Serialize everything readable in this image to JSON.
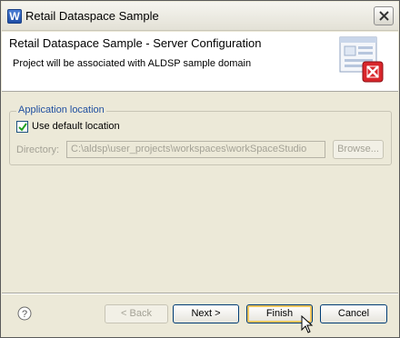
{
  "window": {
    "title": "Retail Dataspace Sample"
  },
  "header": {
    "title": "Retail Dataspace Sample - Server Configuration",
    "description": "Project will be associated with ALDSP sample domain"
  },
  "location_group": {
    "label": "Application location",
    "use_default_label": "Use default location",
    "use_default_checked": true,
    "directory_label": "Directory:",
    "directory_value": "C:\\aldsp\\user_projects\\workspaces\\workSpaceStudio",
    "browse_label": "Browse..."
  },
  "buttons": {
    "back": "< Back",
    "next": "Next >",
    "finish": "Finish",
    "cancel": "Cancel"
  },
  "colors": {
    "group_label": "#2150a0",
    "default_button_ring": "#f5c75e"
  }
}
